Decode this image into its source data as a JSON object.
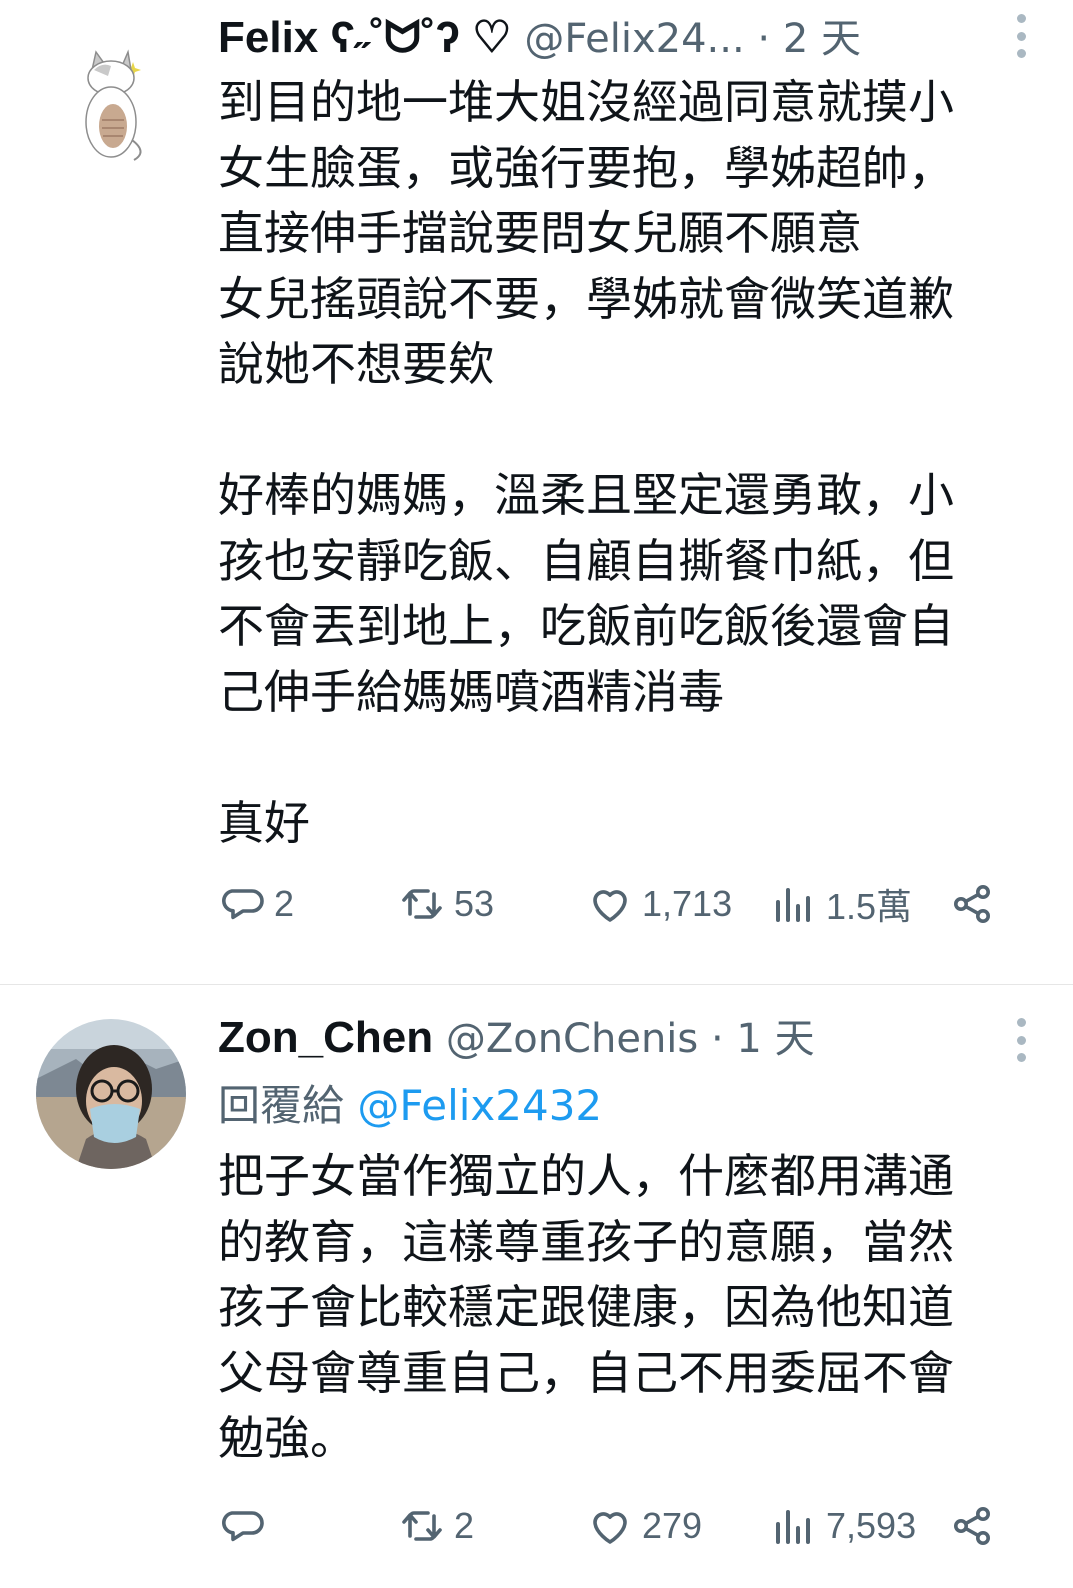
{
  "tweets": [
    {
      "display_name": "Felix ʕ˶˚ᗢ˚ʔ ♡",
      "handle": "@Felix24...",
      "separator": "·",
      "time": "2 天",
      "body": "到目的地一堆大姐沒經過同意就摸小\n女生臉蛋，或強行要抱，學姊超帥，\n直接伸手擋說要問女兒願不願意\n女兒搖頭說不要，學姊就會微笑道歉\n說她不想要欸\n\n好棒的媽媽，溫柔且堅定還勇敢，小\n孩也安靜吃飯、自顧自撕餐巾紙，但\n不會丟到地上，吃飯前吃飯後還會自\n己伸手給媽媽噴酒精消毒\n\n真好",
      "stats": {
        "replies": "2",
        "retweets": "53",
        "likes": "1,713",
        "views": "1.5萬"
      }
    },
    {
      "display_name": "Zon_Chen",
      "handle": "@ZonChenis",
      "separator": "·",
      "time": "1 天",
      "reply_label": "回覆給",
      "reply_to": "@Felix2432",
      "body": "把子女當作獨立的人，什麼都用溝通\n的教育，這樣尊重孩子的意願，當然\n孩子會比較穩定跟健康，因為他知道\n父母會尊重自己，自己不用委屈不會\n勉強。",
      "stats": {
        "replies": "",
        "retweets": "2",
        "likes": "279",
        "views": "7,593"
      }
    }
  ],
  "icons": {
    "reply": "reply-bubble-icon",
    "retweet": "retweet-icon",
    "like": "heart-icon",
    "views": "views-bar-icon",
    "share": "share-icon",
    "menu": "more-vertical-icon"
  },
  "colors": {
    "text": "#0f1419",
    "secondary": "#536471",
    "link": "#1d9bf0",
    "divider": "#e6e6e6"
  }
}
